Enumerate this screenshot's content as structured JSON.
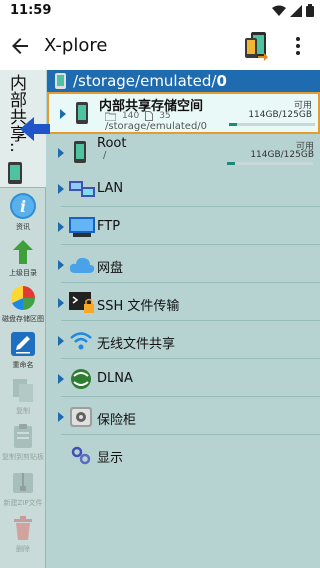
{
  "status_bar": {
    "time": "11:59"
  },
  "app": {
    "title": "X-plore"
  },
  "sidebar": {
    "tab_label": "内部共享...",
    "tools": [
      {
        "label": "资讯",
        "icon": "info-icon",
        "enabled": true
      },
      {
        "label": "上级目录",
        "icon": "up-arrow-icon",
        "enabled": true
      },
      {
        "label": "磁盘存储区图",
        "icon": "disk-map-icon",
        "enabled": true
      },
      {
        "label": "重命名",
        "icon": "rename-icon",
        "enabled": true
      },
      {
        "label": "复制",
        "icon": "copy-icon",
        "enabled": false
      },
      {
        "label": "复制到剪贴板",
        "icon": "clipboard-icon",
        "enabled": false
      },
      {
        "label": "新建ZIP文件",
        "icon": "zip-icon",
        "enabled": false
      },
      {
        "label": "删除",
        "icon": "trash-icon",
        "enabled": false
      }
    ]
  },
  "path_bar": {
    "prefix": "/storage/emulated/",
    "current": "0"
  },
  "storages": [
    {
      "name": "内部共享存储空间",
      "folders": "140",
      "files": "35",
      "path": "/storage/emulated/0",
      "available_label": "可用",
      "size": "114GB/125GB",
      "used_fraction": 0.09,
      "selected": true
    },
    {
      "name": "Root",
      "path": "/",
      "available_label": "可用",
      "size": "114GB/125GB",
      "used_fraction": 0.09,
      "selected": false
    }
  ],
  "network_items": [
    {
      "label": "LAN",
      "icon": "lan-icon"
    },
    {
      "label": "FTP",
      "icon": "ftp-icon"
    },
    {
      "label": "网盘",
      "icon": "cloud-icon"
    },
    {
      "label": "SSH 文件传输",
      "icon": "ssh-icon"
    },
    {
      "label": "无线文件共享",
      "icon": "wifi-share-icon"
    },
    {
      "label": "DLNA",
      "icon": "dlna-icon"
    },
    {
      "label": "保险柜",
      "icon": "vault-icon"
    },
    {
      "label": "显示",
      "icon": "show-icon"
    }
  ]
}
